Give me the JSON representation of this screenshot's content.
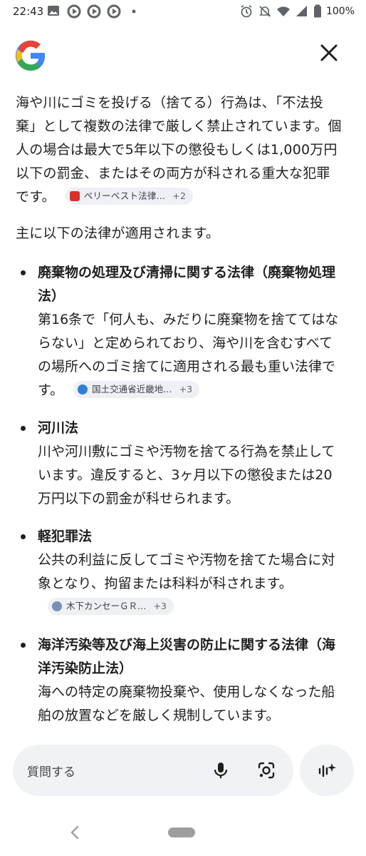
{
  "status_bar": {
    "time": "22:43",
    "battery": "100%",
    "icons_left": [
      "image-icon",
      "cast-icon",
      "cast-icon",
      "cast-icon",
      "dot-icon"
    ],
    "icons_right": [
      "alarm-icon",
      "notifications-off-icon",
      "wifi-icon",
      "signal-icon",
      "battery-icon"
    ]
  },
  "header": {
    "logo": "google-g-logo",
    "close_icon": "close-icon"
  },
  "content": {
    "intro": "海や川にゴミを投げる（捨てる）行為は、「不法投棄」として複数の法律で厳しく禁止されています。個人の場合は最大で5年以下の懲役もしくは1,000万円以下の罰金、またはその両方が科される重大な犯罪です。",
    "intro_chip": {
      "label": "ベリーベスト法律…",
      "count": "+2",
      "favicon_color": "#d9302c"
    },
    "lead": "主に以下の法律が適用されます。",
    "items": [
      {
        "title": "廃棄物の処理及び清掃に関する法律（廃棄物処理法）",
        "body": "第16条で「何人も、みだりに廃棄物を捨ててはならない」と定められており、海や川を含むすべての場所へのゴミ捨てに適用される最も重い法律です。",
        "chip": {
          "label": "国土交通省近畿地…",
          "count": "+3",
          "favicon_color": "#2f7ed8"
        }
      },
      {
        "title": "河川法",
        "body": "川や河川敷にゴミや汚物を捨てる行為を禁止しています。違反すると、3ヶ月以下の懲役または20万円以下の罰金が科せられます。",
        "chip": null
      },
      {
        "title": "軽犯罪法",
        "body": "公共の利益に反してゴミや汚物を捨てた場合に対象となり、拘留または科料が科されます。",
        "chip": {
          "label": "木下カンセーＧＲ…",
          "count": "+3",
          "favicon_color": "#7a8fb5"
        }
      },
      {
        "title": "海洋汚染等及び海上災害の防止に関する法律（海洋汚染防止法）",
        "body": "海への特定の廃棄物投棄や、使用しなくなった船舶の放置などを厳しく規制しています。",
        "chip": null
      }
    ]
  },
  "bottom": {
    "ask_placeholder": "質問する",
    "mic_icon": "mic-icon",
    "lens_icon": "lens-icon",
    "ai_icon": "ai-mode-icon"
  },
  "nav": {
    "back_icon": "back-chevron-icon",
    "home_pill": "home-pill"
  },
  "colors": {
    "text": "#1f1f1f",
    "chip_bg": "#eef0f4",
    "bar_bg": "#f0f2f5",
    "google_blue": "#4285f4",
    "google_red": "#ea4335",
    "google_yellow": "#fbbc05",
    "google_green": "#34a853"
  }
}
